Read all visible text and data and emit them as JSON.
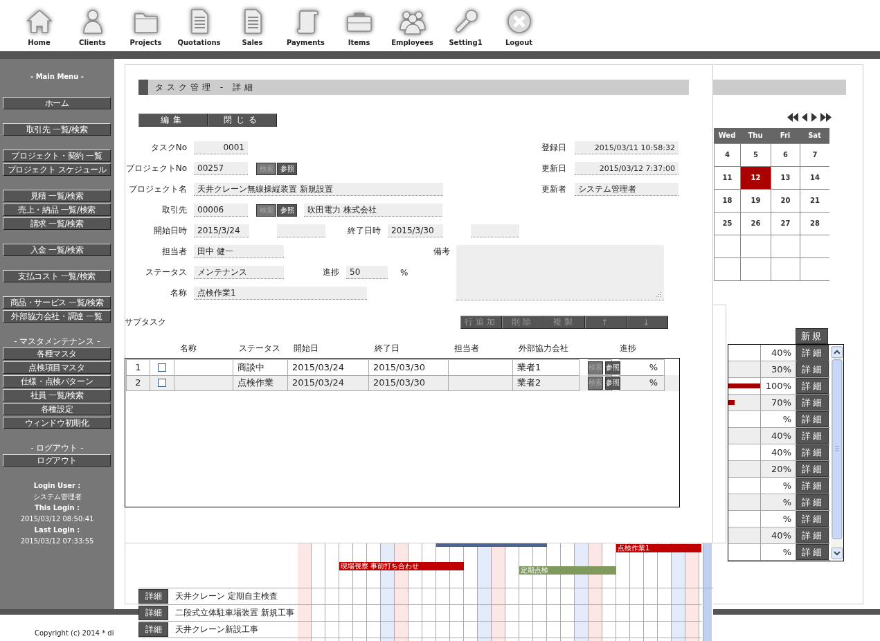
{
  "nav": [
    {
      "label": "Home",
      "kind": "home"
    },
    {
      "label": "Clients",
      "kind": "person"
    },
    {
      "label": "Projects",
      "kind": "folder"
    },
    {
      "label": "Quotations",
      "kind": "document"
    },
    {
      "label": "Sales",
      "kind": "document"
    },
    {
      "label": "Payments",
      "kind": "scroll"
    },
    {
      "label": "Items",
      "kind": "toolbox"
    },
    {
      "label": "Employees",
      "kind": "people"
    },
    {
      "label": "Setting1",
      "kind": "wrench"
    },
    {
      "label": "Logout",
      "kind": "logout"
    }
  ],
  "sidebar": {
    "sections": [
      {
        "heading": "- Main Menu -",
        "items": [
          "ホーム"
        ]
      },
      {
        "items": [
          "取引先 一覧/検索"
        ]
      },
      {
        "items": [
          "プロジェクト・契約 一覧",
          "プロジェクト スケジュール"
        ]
      },
      {
        "items": [
          "見積 一覧/検索",
          "売上・納品 一覧/検索",
          "請求 一覧/検索"
        ]
      },
      {
        "items": [
          "入金 一覧/検索"
        ]
      },
      {
        "items": [
          "支払コスト 一覧/検索"
        ]
      },
      {
        "items": [
          "商品・サービス 一覧/検索",
          "外部協力会社・調達 一覧"
        ]
      },
      {
        "heading": "- マスタメンテナンス -",
        "items": [
          "各種マスタ",
          "点検項目マスタ",
          "仕様・点検パターン",
          "社員 一覧/検索",
          "各種設定",
          "ウィンドウ初期化"
        ]
      },
      {
        "heading": "- ログアウト -",
        "items": [
          "ログアウト"
        ]
      }
    ],
    "login": [
      {
        "label": "Login User :",
        "value": "システム管理者"
      },
      {
        "label": "This Login :",
        "value": "2015/03/12 08:50:41"
      },
      {
        "label": "Last Login :",
        "value": "2015/03/12 07:33:55"
      }
    ]
  },
  "calendar": {
    "weekdays": [
      "Wed",
      "Thu",
      "Fri",
      "Sat"
    ],
    "weeks": [
      [
        {
          "day": "4",
          "selected": false
        },
        {
          "day": "5",
          "selected": false
        },
        {
          "day": "6",
          "selected": false
        },
        {
          "day": "7",
          "selected": false
        }
      ],
      [
        {
          "day": "11",
          "selected": false
        },
        {
          "day": "12",
          "selected": true
        },
        {
          "day": "13",
          "selected": false
        },
        {
          "day": "14",
          "selected": false
        }
      ],
      [
        {
          "day": "18",
          "selected": false
        },
        {
          "day": "19",
          "selected": false
        },
        {
          "day": "20",
          "selected": false
        },
        {
          "day": "21",
          "selected": false
        }
      ],
      [
        {
          "day": "25",
          "selected": false
        },
        {
          "day": "26",
          "selected": false
        },
        {
          "day": "27",
          "selected": false
        },
        {
          "day": "28",
          "selected": false
        }
      ],
      [
        {
          "selected": false
        },
        {
          "selected": false
        },
        {
          "selected": false
        },
        {
          "selected": false
        }
      ],
      [
        {
          "selected": false
        },
        {
          "selected": false
        },
        {
          "selected": false
        },
        {
          "selected": false
        }
      ]
    ]
  },
  "task_list": {
    "new_button": "新規",
    "rows": [
      {
        "progress": "40%",
        "action": "詳細"
      },
      {
        "progress": "30%",
        "action": "詳細"
      },
      {
        "progress": "100%",
        "action": "詳細",
        "level": 1
      },
      {
        "progress": "70%",
        "action": "詳細",
        "level": 0.2
      },
      {
        "progress": "%",
        "action": "詳細"
      },
      {
        "progress": "40%",
        "action": "詳細"
      },
      {
        "progress": "40%",
        "action": "詳細"
      },
      {
        "progress": "20%",
        "action": "詳細"
      },
      {
        "progress": "%",
        "action": "詳細"
      },
      {
        "progress": "%",
        "action": "詳細"
      },
      {
        "progress": "%",
        "action": "詳細"
      },
      {
        "progress": "40%",
        "action": "詳細"
      },
      {
        "progress": "%",
        "action": "詳細"
      }
    ]
  },
  "task_dialog": {
    "title": "タスク管理 - 詳細",
    "actions": [
      "編集",
      "閉じる"
    ],
    "fields": [
      {
        "label": "タスクNo",
        "value": "0001"
      },
      {
        "label": "プロジェクトNo",
        "value": "00257",
        "lookup": [
          {
            "label": "検索",
            "disabled": true
          },
          {
            "label": "参照",
            "disabled": false
          }
        ]
      },
      {
        "label": "プロジェクト名",
        "value": "天井クレーン無線操縦装置 新規設置"
      },
      {
        "label": "取引先",
        "value": "00006",
        "lookup": [
          {
            "label": "検索",
            "disabled": true
          },
          {
            "label": "参照",
            "disabled": false
          }
        ],
        "name_value": "吹田電力 株式会社"
      },
      {
        "label": "開始日時",
        "value": "2015/3/24"
      },
      {
        "label": "終了日時",
        "value": "2015/3/30"
      },
      {
        "label": "担当者",
        "value": "田中 健一"
      },
      {
        "label": "ステータス",
        "value": "メンテナンス"
      },
      {
        "label": "進捗",
        "value": "50",
        "unit": "%"
      },
      {
        "label": "名称",
        "value": "点検作業1"
      },
      {
        "label": "備考"
      },
      {
        "label": "登録日",
        "value": "2015/03/11 10:58:32"
      },
      {
        "label": "更新日",
        "value": "2015/03/12 7:37:00"
      },
      {
        "label": "更新者",
        "value": "システム管理者"
      }
    ],
    "subtasks": {
      "label": "サブタスク",
      "toolbar": [
        {
          "label": "行追加",
          "disabled": true
        },
        {
          "label": "削除",
          "disabled": true
        },
        {
          "label": "複製",
          "disabled": true
        },
        {
          "label": "↑",
          "disabled": true
        },
        {
          "label": "↓",
          "disabled": true
        }
      ],
      "columns": [
        "名称",
        "ステータス",
        "開始日",
        "終了日",
        "担当者",
        "外部協力会社",
        "進捗"
      ],
      "rows": [
        {
          "no": "1",
          "checked": false,
          "status": "商談中",
          "start": "2015/03/24",
          "end": "2015/03/30",
          "vendor": "業者1",
          "lookup": [
            {
              "label": "検索",
              "disabled": true
            },
            {
              "label": "参照",
              "disabled": false
            }
          ],
          "progress": "%"
        },
        {
          "no": "2",
          "checked": false,
          "status": "点検作業",
          "start": "2015/03/24",
          "end": "2015/03/30",
          "vendor": "業者2",
          "lookup": [
            {
              "label": "検索",
              "disabled": true
            },
            {
              "label": "参照",
              "disabled": false
            }
          ],
          "progress": "%"
        }
      ]
    }
  },
  "schedule": {
    "bars": [
      {
        "label": "点検作業1",
        "color": "#c00000"
      },
      {
        "color": "#4a6590"
      },
      {
        "label": "現場視察 事前打ち合わせ",
        "color": "#c00000"
      },
      {
        "label": "定期点検",
        "color": "#7f9a5c"
      }
    ],
    "rows": [
      {
        "action": "詳細",
        "name": "天井クレーン 定期自主検査"
      },
      {
        "action": "詳細",
        "name": "二段式立体駐車場装置 新規工事"
      },
      {
        "action": "詳細",
        "name": "天井クレーン新設工事"
      }
    ]
  },
  "footer": {
    "copyright": "Copyright (c) 2014 * di"
  }
}
